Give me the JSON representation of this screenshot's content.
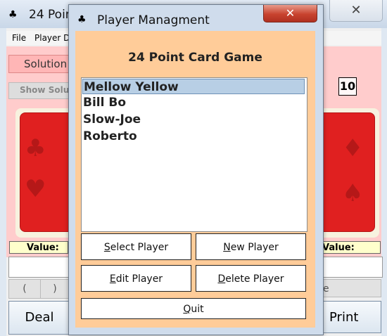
{
  "main_window": {
    "title": "24 Poin",
    "close_glyph": "✕",
    "menu": {
      "file": "File",
      "player": "Player Da"
    },
    "solution_label": "Solution",
    "show_solution_label": "Show Soluti",
    "target_number": "10",
    "value_left": "Value:",
    "value_right": "Value:",
    "paren_open": "(",
    "paren_close": ")",
    "partial_e": "e",
    "deal_button": "Deal",
    "print_button": "Print"
  },
  "dialog": {
    "title": "Player Managment",
    "close_glyph": "✕",
    "heading": "24 Point Card Game",
    "players": [
      "Mellow Yellow",
      "Bill Bo",
      "Slow-Joe",
      "Roberto"
    ],
    "selected_index": 0,
    "buttons": {
      "select": {
        "mnemonic": "S",
        "rest": "elect Player"
      },
      "new": {
        "mnemonic": "N",
        "rest": "ew Player"
      },
      "edit": {
        "mnemonic": "E",
        "rest": "dit Player"
      },
      "delete": {
        "mnemonic": "D",
        "rest": "elete Player"
      },
      "quit": {
        "mnemonic": "Q",
        "rest": "uit"
      }
    }
  },
  "icons": {
    "app_icon": "card-suits-icon",
    "close_icon": "close-icon"
  },
  "colors": {
    "pink_panel": "#ffcccc",
    "dialog_body": "#ffcc99",
    "selected_row": "#b8cfe5",
    "card_red": "#e02020",
    "value_yellow": "#ffffcc"
  }
}
